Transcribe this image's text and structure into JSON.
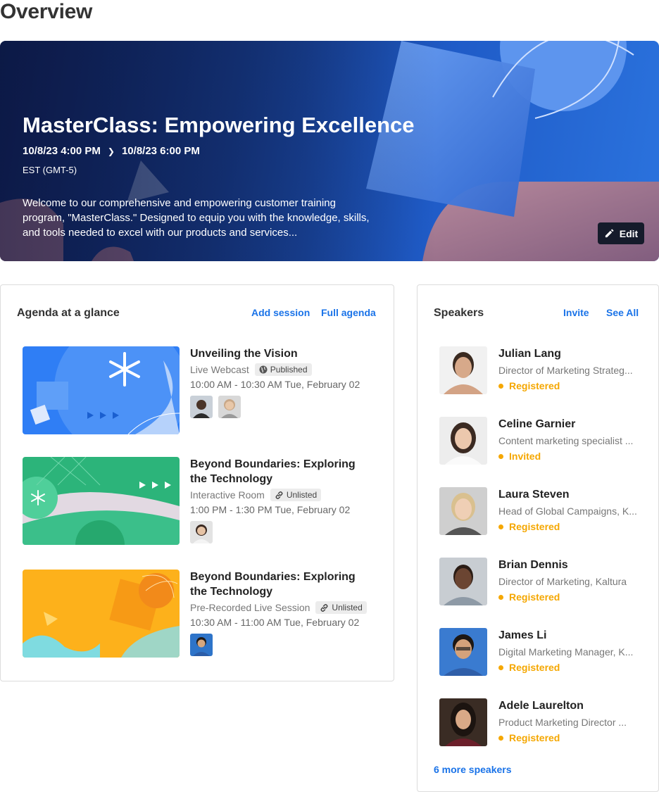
{
  "page": {
    "title": "Overview"
  },
  "hero": {
    "title": "MasterClass: Empowering Excellence",
    "start": "10/8/23 4:00 PM",
    "end": "10/8/23 6:00 PM",
    "timezone": "EST (GMT-5)",
    "description": "Welcome to our comprehensive and empowering customer training program, \"MasterClass.\" Designed to equip you with the knowledge, skills, and tools needed to excel with our products and services...",
    "edit_label": "Edit"
  },
  "agenda": {
    "title": "Agenda at a glance",
    "add_label": "Add session",
    "full_label": "Full agenda",
    "sessions": [
      {
        "title": "Unveiling the Vision",
        "type": "Live Webcast",
        "badge": "Published",
        "badge_icon": "globe-icon",
        "time": "10:00 AM - 10:30 AM",
        "date": "Tue, February 02"
      },
      {
        "title": "Beyond Boundaries: Exploring the Technology",
        "type": "Interactive Room",
        "badge": "Unlisted",
        "badge_icon": "link-icon",
        "time": "1:00 PM - 1:30 PM",
        "date": "Tue, February 02"
      },
      {
        "title": "Beyond Boundaries: Exploring the Technology",
        "type": "Pre-Recorded Live Session",
        "badge": "Unlisted",
        "badge_icon": "link-icon",
        "time": "10:30 AM - 11:00 AM",
        "date": "Tue, February 02"
      }
    ]
  },
  "speakers": {
    "title": "Speakers",
    "invite_label": "Invite",
    "see_all_label": "See All",
    "list": [
      {
        "name": "Julian Lang",
        "role": "Director of Marketing Strateg...",
        "status": "Registered"
      },
      {
        "name": "Celine Garnier",
        "role": "Content marketing specialist ...",
        "status": "Invited"
      },
      {
        "name": "Laura Steven",
        "role": "Head of Global Campaigns, K...",
        "status": "Registered"
      },
      {
        "name": "Brian Dennis",
        "role": "Director of Marketing, Kaltura",
        "status": "Registered"
      },
      {
        "name": "James Li",
        "role": "Digital Marketing Manager, K...",
        "status": "Registered"
      },
      {
        "name": "Adele Laurelton",
        "role": "Product Marketing Director ...",
        "status": "Registered"
      }
    ],
    "more_label": "6 more speakers"
  },
  "colors": {
    "accent": "#1a73e8",
    "status": "#f5a700",
    "edit_bg": "#151b2b"
  }
}
